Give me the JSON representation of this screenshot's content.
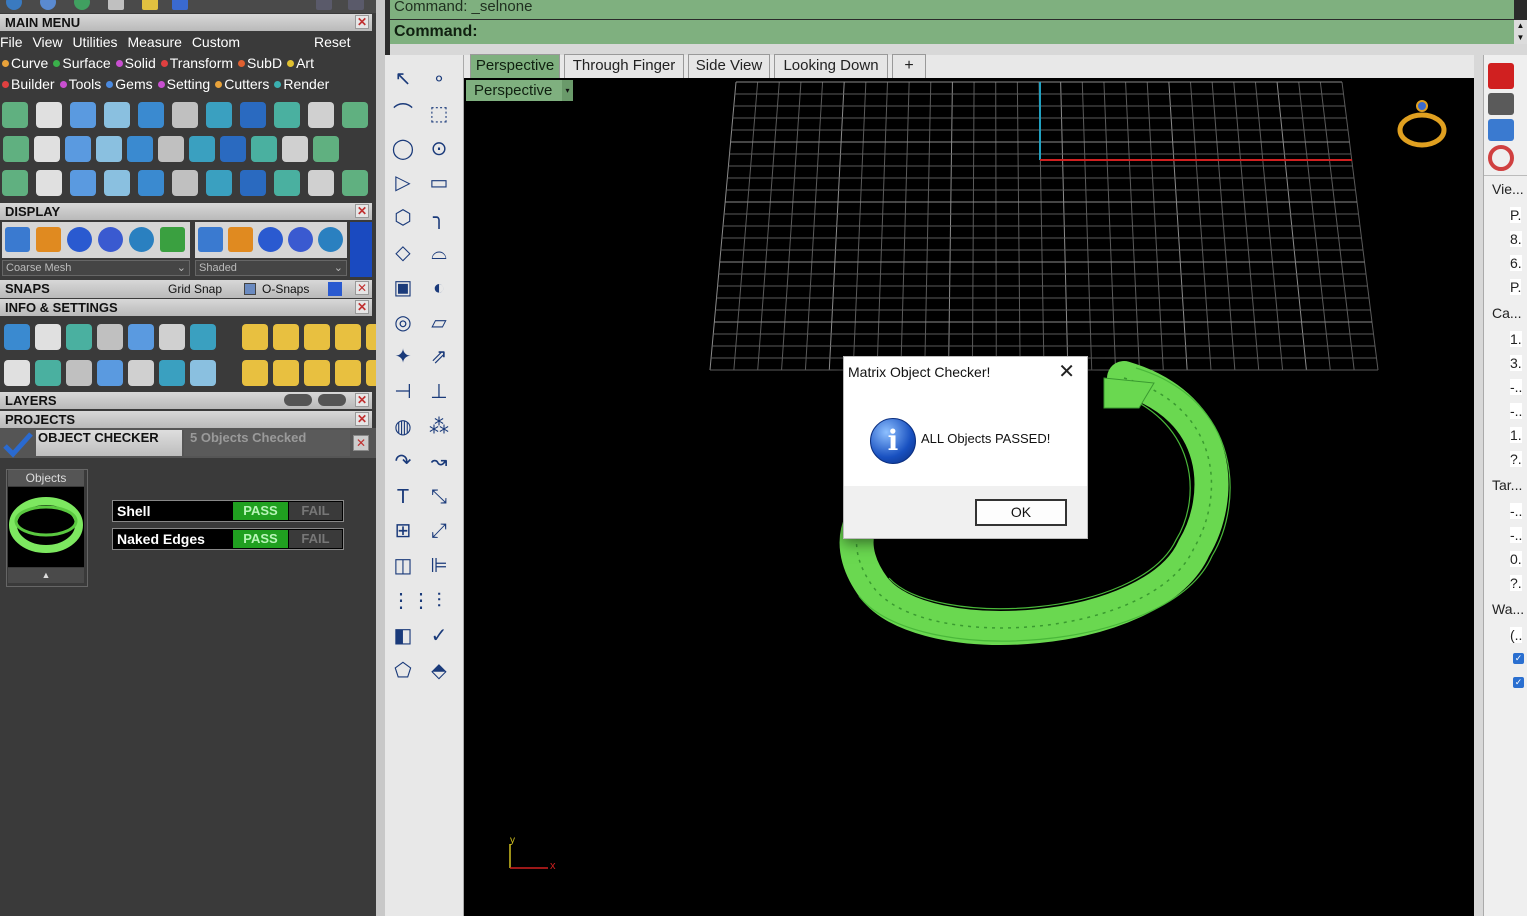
{
  "command": {
    "history": "Command: _selnone",
    "prompt": "Command:"
  },
  "left_panel": {
    "main_menu_title": "MAIN MENU",
    "menu": [
      "File",
      "View",
      "Utilities",
      "Measure",
      "Custom"
    ],
    "menu_reset": "Reset",
    "plugins_row1": [
      {
        "label": "Curve",
        "color": "#e8a23a"
      },
      {
        "label": "Surface",
        "color": "#3aaf4a"
      },
      {
        "label": "Solid",
        "color": "#c84fd0"
      },
      {
        "label": "Transform",
        "color": "#e04040"
      },
      {
        "label": "SubD",
        "color": "#e06030"
      },
      {
        "label": "Art",
        "color": "#e0c030"
      }
    ],
    "plugins_row2": [
      {
        "label": "Builder",
        "color": "#e04040"
      },
      {
        "label": "Tools",
        "color": "#c84fd0"
      },
      {
        "label": "Gems",
        "color": "#4a8ae0"
      },
      {
        "label": "Setting",
        "color": "#c84fd0"
      },
      {
        "label": "Cutters",
        "color": "#e8a23a"
      },
      {
        "label": "Render",
        "color": "#3ab0b0"
      }
    ],
    "display_title": "DISPLAY",
    "mesh_combo": "Coarse Mesh",
    "shade_combo": "Shaded",
    "snaps_title": "SNAPS",
    "grid_snap": "Grid Snap",
    "osnaps": "O-Snaps",
    "info_title": "INFO & SETTINGS",
    "layers_title": "LAYERS",
    "projects_title": "PROJECTS",
    "object_checker": {
      "title": "OBJECT CHECKER",
      "count_text": "5  Objects Checked",
      "objects_label": "Objects",
      "collapse_glyph": "▲",
      "checks": [
        {
          "label": "Shell",
          "pass": "PASS",
          "fail": "FAIL"
        },
        {
          "label": "Naked Edges",
          "pass": "PASS",
          "fail": "FAIL"
        }
      ]
    }
  },
  "viewport_tabs": [
    "Perspective",
    "Through Finger",
    "Side View",
    "Looking Down"
  ],
  "add_tab_glyph": "+",
  "viewport": {
    "label": "Perspective",
    "dropdown_glyph": "▾",
    "axis_y": "y",
    "axis_x": "x"
  },
  "right_panel": {
    "sections": [
      "Vie...",
      "Ca...",
      "Tar...",
      "Wa..."
    ],
    "values": [
      "P.",
      "8.",
      "6.",
      "P.",
      "1.",
      "3.",
      "-..",
      "-..",
      "1.",
      "?.",
      "-..",
      "-..",
      "0.",
      "?.",
      "(.."
    ]
  },
  "dialog": {
    "title": "Matrix Object Checker!",
    "close": "✕",
    "icon_glyph": "i",
    "message": "ALL Objects PASSED!",
    "ok": "OK"
  },
  "colors": {
    "command_bg": "#7fb07f",
    "pass_green": "#20a020",
    "ring_green": "#7de860",
    "axis_red": "#d02020",
    "axis_blue": "#20a0c0"
  }
}
